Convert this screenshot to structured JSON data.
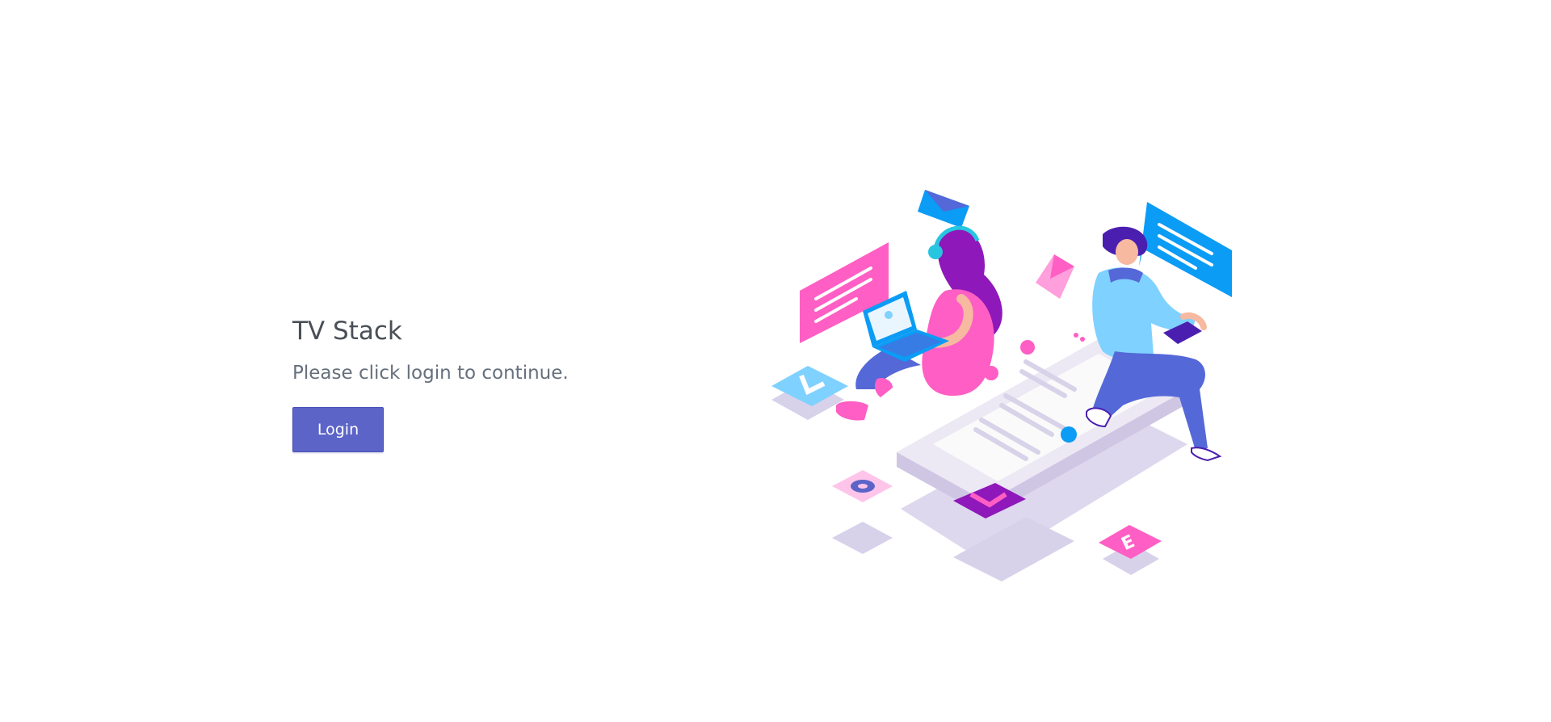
{
  "app": {
    "title": "TV Stack",
    "subtitle": "Please click login to continue.",
    "login_label": "Login"
  },
  "illustration": {
    "tiles": [
      "L",
      "O",
      "V",
      "E"
    ]
  },
  "colors": {
    "primary": "#5c64c8",
    "title_text": "#4a4f57",
    "subtitle_text": "#66707c",
    "pink": "#ff5ec4",
    "blue": "#0b9cf5",
    "purple": "#8e18b9",
    "lavender": "#d7d2ea"
  }
}
